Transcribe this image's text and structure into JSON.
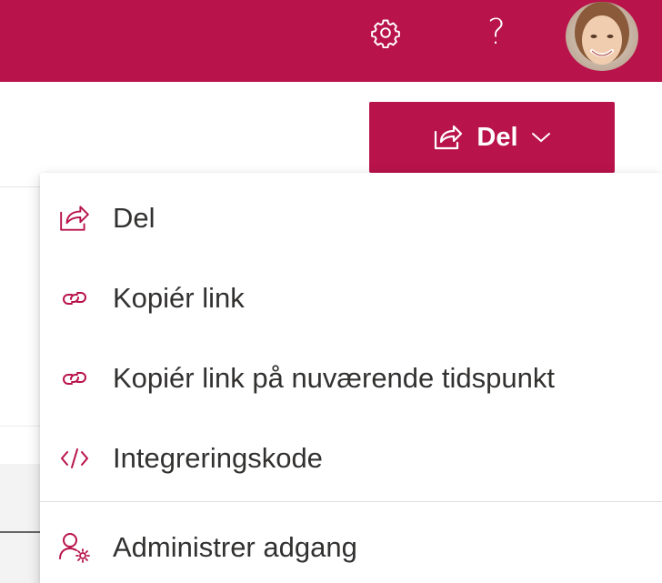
{
  "header": {
    "settings_icon": "gear-icon",
    "help_label": "?",
    "avatar_icon": "user-avatar",
    "brand_color": "#b8134a"
  },
  "command_bar": {
    "share_button": {
      "label": "Del",
      "icon": "share-icon",
      "chevron_icon": "chevron-down-icon"
    }
  },
  "share_menu": {
    "items": [
      {
        "label": "Del",
        "icon": "share-icon"
      },
      {
        "label": "Kopiér link",
        "icon": "link-icon"
      },
      {
        "label": "Kopiér link på nuværende tidspunkt",
        "icon": "link-icon"
      },
      {
        "label": "Integreringskode",
        "icon": "embed-code-icon"
      },
      {
        "label": "Administrer adgang",
        "icon": "manage-access-icon"
      }
    ],
    "icon_color": "#b8134a"
  }
}
